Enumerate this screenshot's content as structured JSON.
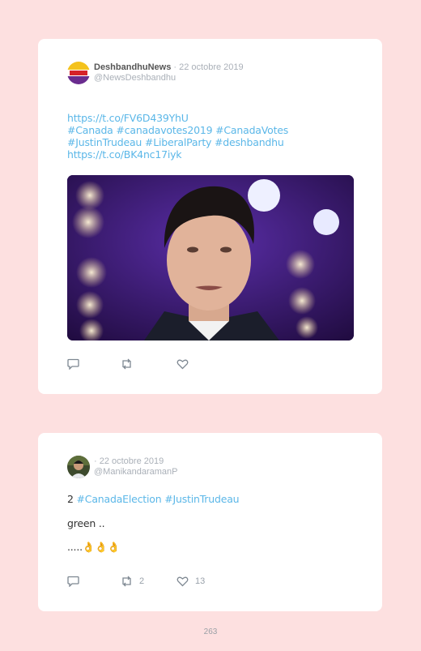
{
  "tweets": [
    {
      "author_name": "DeshbandhuNews",
      "date": " · 22 octobre 2019",
      "handle": "@NewsDeshbandhu",
      "lines": [
        "https://t.co/FV6D439YhU",
        "#Canada #canadavotes2019 #CanadaVotes",
        "#JustinTrudeau #LiberalParty #deshbandhu",
        "https://t.co/BK4nc17iyk"
      ]
    },
    {
      "author_name": "",
      "date": " · 22 octobre 2019",
      "handle": "@ManikandaramanP",
      "line1_prefix": "2 ",
      "line1_tags": "#CanadaElection #JustinTrudeau",
      "line2": "green ..",
      "line3": ".....👌👌👌",
      "retweets": "2",
      "likes": "13"
    }
  ],
  "page_number": "263",
  "colors": {
    "background": "#fde0e0",
    "link": "#5bb7e8",
    "card": "#ffffff"
  },
  "icons": [
    "reply-icon",
    "retweet-icon",
    "like-icon"
  ]
}
